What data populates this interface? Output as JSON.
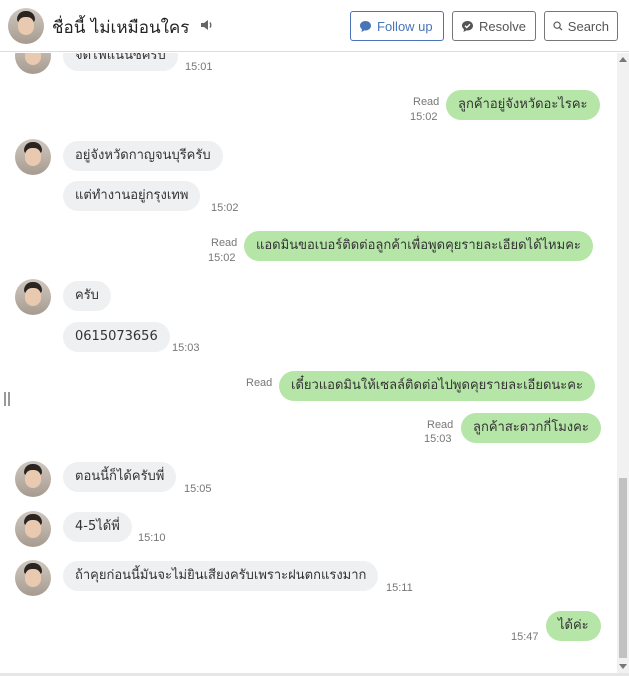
{
  "header": {
    "contact_name": "ชื่อนี้ ไม่เหมือนใคร",
    "follow_up_label": "Follow up",
    "resolve_label": "Resolve",
    "search_label": "Search"
  },
  "colors": {
    "accent": "#4a74b8",
    "outgoing_bubble": "#b6e5a8",
    "incoming_bubble": "#eef0f2"
  },
  "messages": [
    {
      "dir": "in",
      "text": "จัดไฟแนนซ์ครับ",
      "time": "15:01"
    },
    {
      "dir": "out",
      "text": "ลูกค้าอยู่จังหวัดอะไรคะ",
      "status": "Read",
      "time": "15:02"
    },
    {
      "dir": "in",
      "text": "อยู่จังหวัดกาญจนบุรีครับ",
      "time": ""
    },
    {
      "dir": "in",
      "text": "แต่ทำงานอยู่กรุงเทพ",
      "time": "15:02"
    },
    {
      "dir": "out",
      "text": "แอดมินขอเบอร์ติดต่อลูกค้าเพื่อพูดคุยรายละเอียดได้ไหมคะ",
      "status": "Read",
      "time": "15:02"
    },
    {
      "dir": "in",
      "text": "ครับ",
      "time": ""
    },
    {
      "dir": "in",
      "text": "0615073656",
      "time": "15:03"
    },
    {
      "dir": "out",
      "text": "เดี๋ยวแอดมินให้เซลล์ติดต่อไปพูดคุยรายละเอียดนะคะ",
      "status": "Read",
      "time": ""
    },
    {
      "dir": "out",
      "text": "ลูกค้าสะดวกกี่โมงคะ",
      "status": "Read",
      "time": "15:03"
    },
    {
      "dir": "in",
      "text": "ตอนนี้ก็ได้ครับพี่",
      "time": "15:05"
    },
    {
      "dir": "in",
      "text": "4-5ได้พี่",
      "time": "15:10"
    },
    {
      "dir": "in",
      "text": "ถ้าคุยก่อนนี้มันจะไม่ยินเสียงครับเพราะฝนตกแรงมาก",
      "time": "15:11"
    },
    {
      "dir": "out",
      "text": "ได้ค่ะ",
      "time": "15:47"
    }
  ]
}
